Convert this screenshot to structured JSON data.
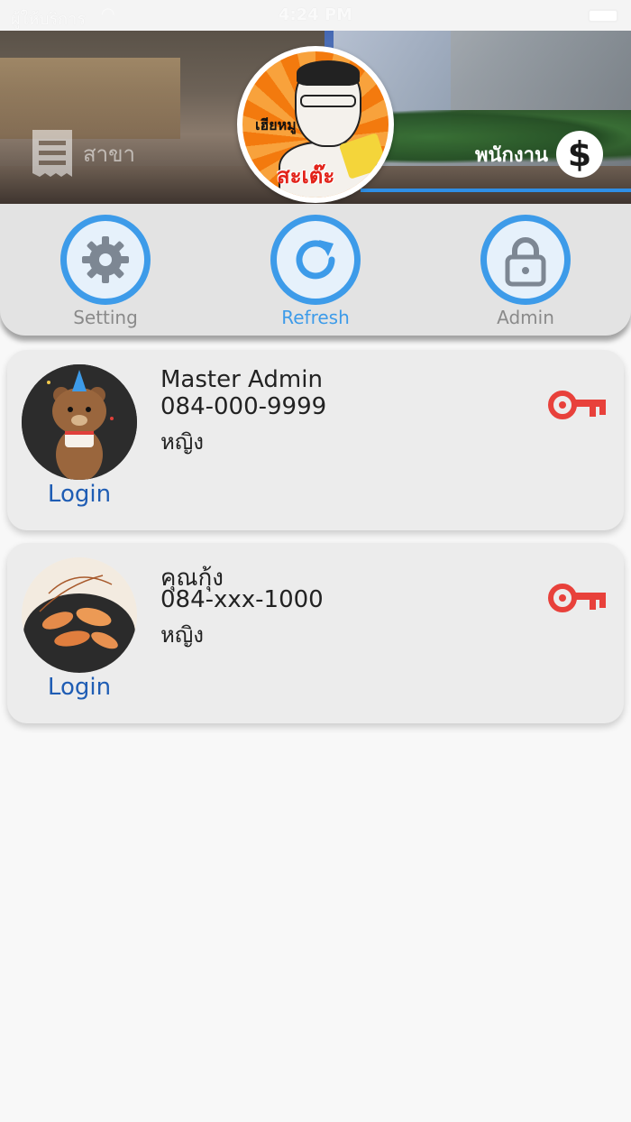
{
  "status_bar": {
    "carrier": "ผู้ให้บริการ",
    "time": "4:24 PM"
  },
  "header": {
    "branch_label": "สาขา",
    "staff_label": "พนักงาน",
    "logo_text_top": "เฮียหมู",
    "logo_text_main": "สะเต๊ะ"
  },
  "actions": {
    "setting_label": "Setting",
    "refresh_label": "Refresh",
    "admin_label": "Admin"
  },
  "users": [
    {
      "name": "Master Admin",
      "phone": "084-000-9999",
      "gender": "หญิง",
      "login_label": "Login"
    },
    {
      "name": "คุณกุ้ง",
      "phone": "084-xxx-1000",
      "gender": "หญิง",
      "login_label": "Login"
    }
  ],
  "colors": {
    "accent_blue": "#3d9be9",
    "key_red": "#e8413b",
    "login_blue": "#1f5db4"
  }
}
